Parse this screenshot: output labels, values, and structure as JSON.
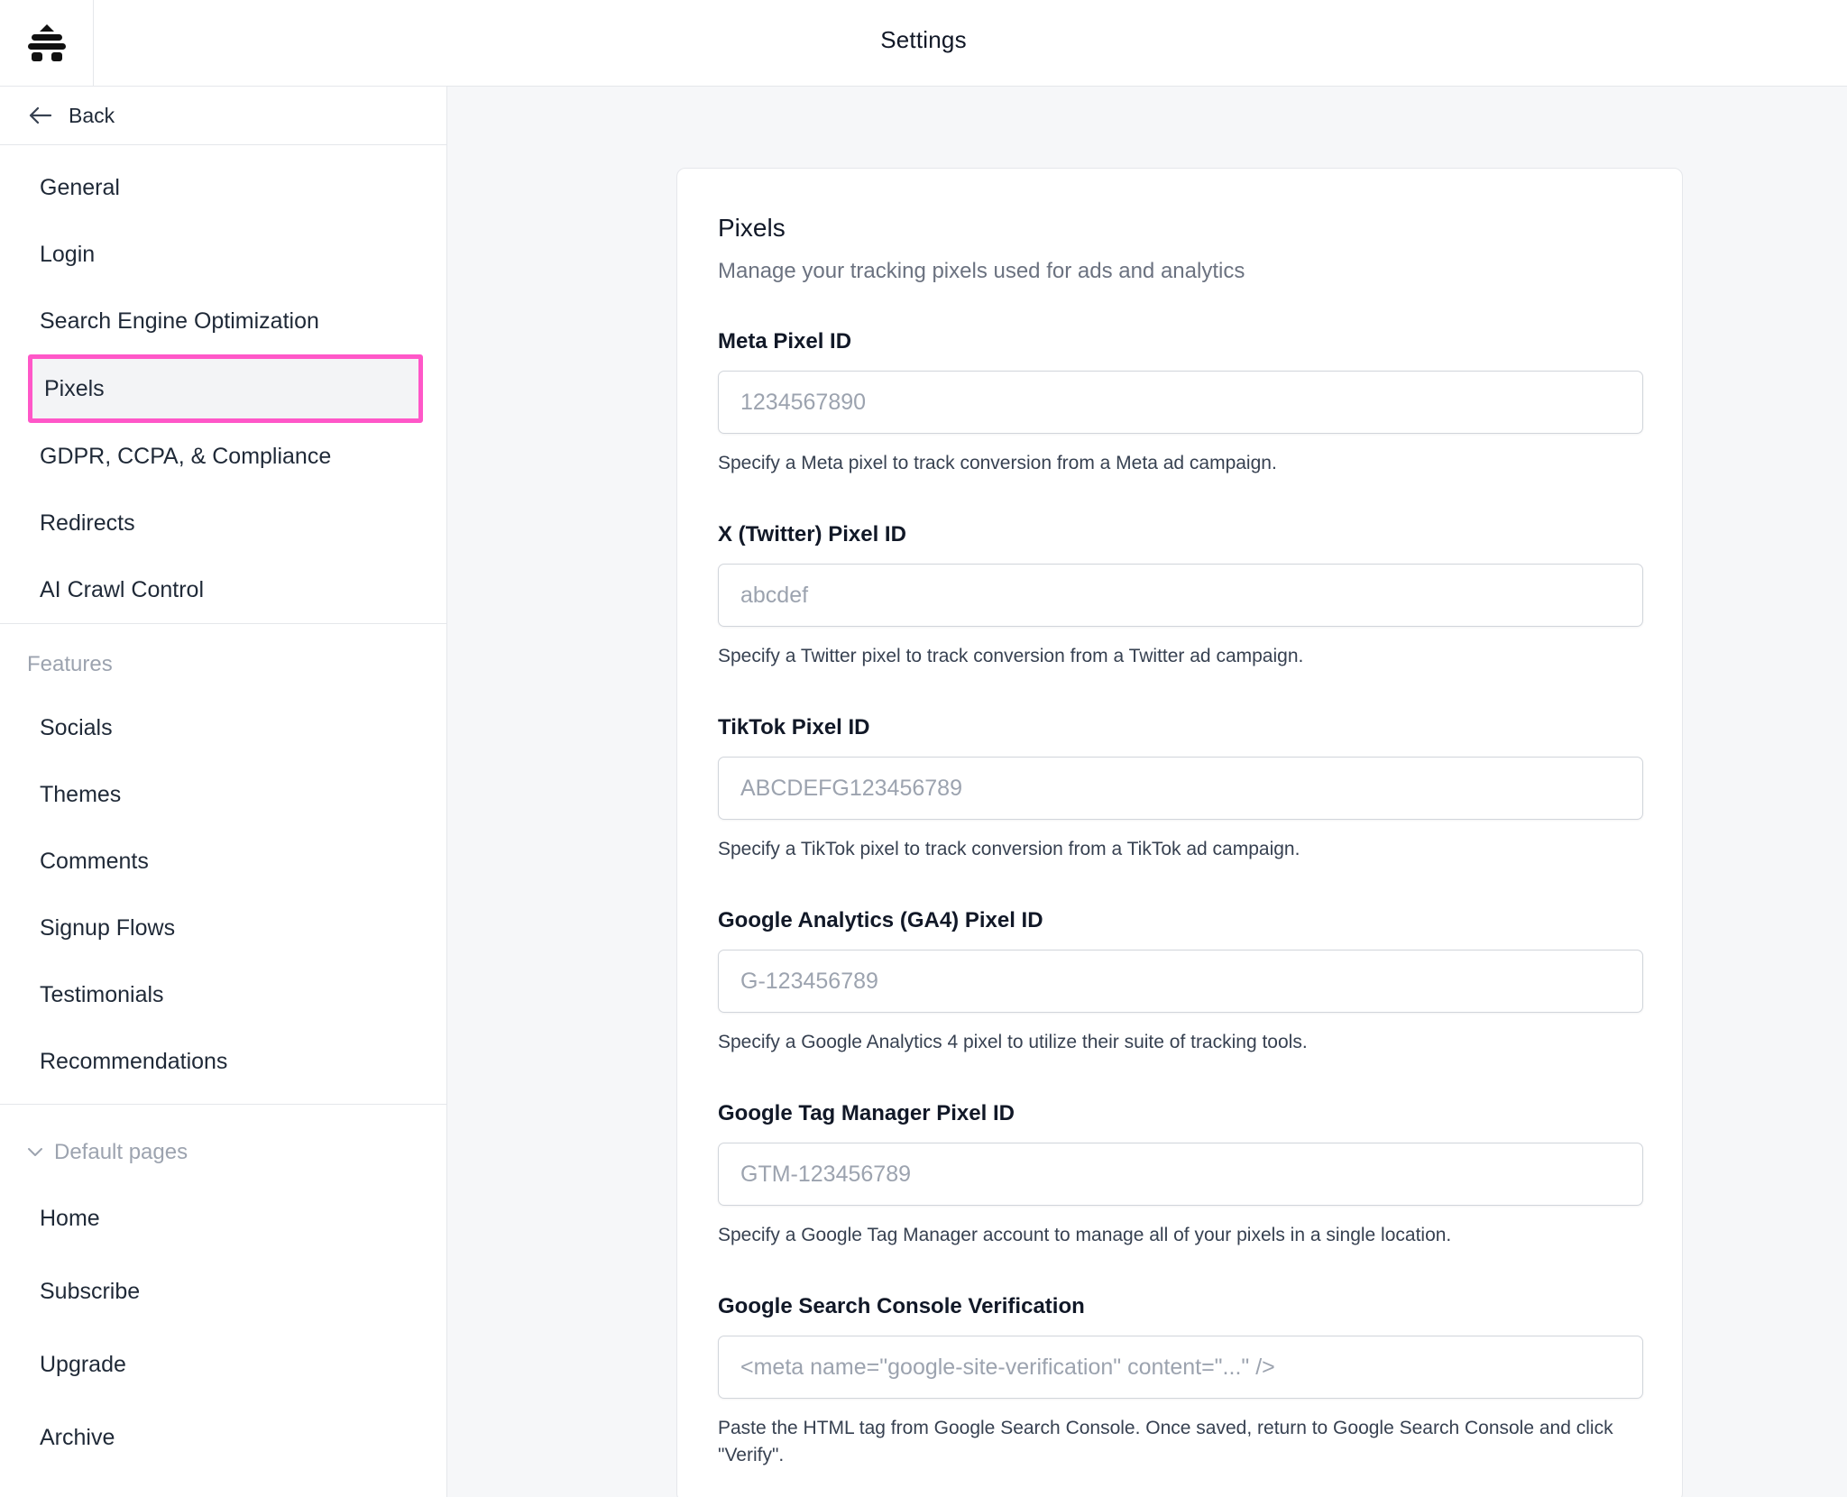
{
  "header": {
    "title": "Settings",
    "logo_icon": "beehiiv-logo-icon"
  },
  "sidebar": {
    "back_label": "Back",
    "main_items": [
      {
        "label": "General"
      },
      {
        "label": "Login"
      },
      {
        "label": "Search Engine Optimization"
      },
      {
        "label": "Pixels",
        "active": true
      },
      {
        "label": "GDPR, CCPA, & Compliance"
      },
      {
        "label": "Redirects"
      },
      {
        "label": "AI Crawl Control"
      }
    ],
    "features_heading": "Features",
    "feature_items": [
      {
        "label": "Socials"
      },
      {
        "label": "Themes"
      },
      {
        "label": "Comments"
      },
      {
        "label": "Signup Flows"
      },
      {
        "label": "Testimonials"
      },
      {
        "label": "Recommendations"
      }
    ],
    "default_pages_heading": "Default pages",
    "default_page_items": [
      {
        "label": "Home"
      },
      {
        "label": "Subscribe"
      },
      {
        "label": "Upgrade"
      },
      {
        "label": "Archive"
      }
    ],
    "highlight_color": "#ff57c8"
  },
  "card": {
    "title": "Pixels",
    "subtitle": "Manage your tracking pixels used for ads and analytics",
    "fields": [
      {
        "label": "Meta Pixel ID",
        "placeholder": "1234567890",
        "value": "",
        "help": "Specify a Meta pixel to track conversion from a Meta ad campaign."
      },
      {
        "label": "X (Twitter) Pixel ID",
        "placeholder": "abcdef",
        "value": "",
        "help": "Specify a Twitter pixel to track conversion from a Twitter ad campaign."
      },
      {
        "label": "TikTok Pixel ID",
        "placeholder": "ABCDEFG123456789",
        "value": "",
        "help": "Specify a TikTok pixel to track conversion from a TikTok ad campaign."
      },
      {
        "label": "Google Analytics (GA4) Pixel ID",
        "placeholder": "G-123456789",
        "value": "",
        "help": "Specify a Google Analytics 4 pixel to utilize their suite of tracking tools."
      },
      {
        "label": "Google Tag Manager Pixel ID",
        "placeholder": "GTM-123456789",
        "value": "",
        "help": "Specify a Google Tag Manager account to manage all of your pixels in a single location."
      },
      {
        "label": "Google Search Console Verification",
        "placeholder": "<meta name=\"google-site-verification\" content=\"...\" />",
        "value": "",
        "help": "Paste the HTML tag from Google Search Console. Once saved, return to Google Search Console and click \"Verify\"."
      }
    ]
  }
}
